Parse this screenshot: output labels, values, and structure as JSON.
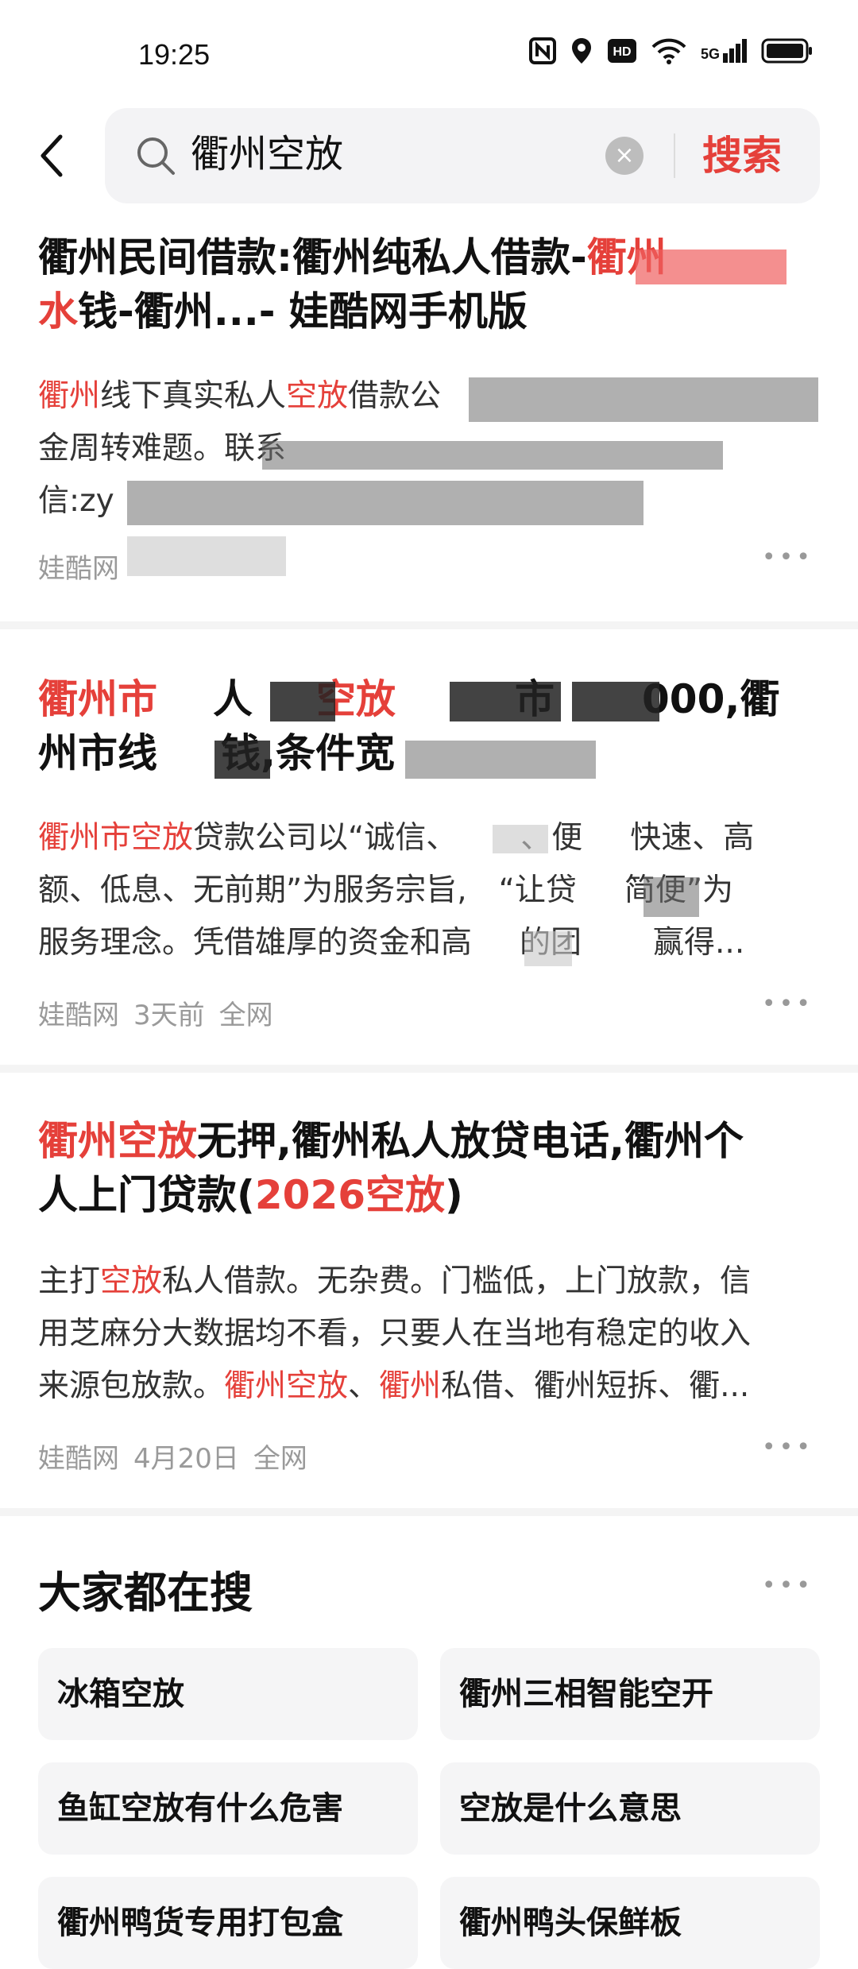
{
  "status_bar": {
    "time": "19:25",
    "network": "5G"
  },
  "search": {
    "query": "衢州空放",
    "button_label": "搜索"
  },
  "results": [
    {
      "title_parts": [
        "衢州民间借款:衢州纯私人借款-",
        "衢州",
        "",
        "水",
        "钱-衢州...- 娃酷网手机版"
      ],
      "snippet": {
        "l1a": "衢州",
        "l1b": "线下真实私人",
        "l1c": "空放",
        "l1d": "借款公",
        "l2": "金周转难题。联系",
        "l3": "信:zy"
      },
      "meta": {
        "source": "娃酷网"
      }
    },
    {
      "title_line1": {
        "a": "衢州市",
        "b": "人",
        "c": "空放",
        "d": "市",
        "e": "000,衢"
      },
      "title_line2": {
        "a": "州市线",
        "b": "钱,条件宽"
      },
      "snippet": {
        "l1a": "衢州市空放",
        "l1b": "贷款公司以“诚信、",
        "l1c": "、便",
        "l1d": "快速、高",
        "l2a": "额、低息、无前期”为服务宗旨,",
        "l2b": "“让贷",
        "l2c": "简便”为",
        "l3a": "服务理念。凭借雄厚的资金和高",
        "l3b": "的团",
        "l3c": "赢得..."
      },
      "meta": {
        "source": "娃酷网",
        "time": "3天前",
        "scope": "全网"
      }
    },
    {
      "title_line1": {
        "hl": "衢州空放",
        "rest": "无押,衢州私人放贷电话,衢州个"
      },
      "title_line2": {
        "a": "人上门贷款(",
        "hl": "2026空放",
        "b": ")"
      },
      "snippet": {
        "l1a": "主打",
        "l1hl": "空放",
        "l1b": "私人借款。无杂费。门槛低，上门放款，信",
        "l2": "用芝麻分大数据均不看，只要人在当地有稳定的收入",
        "l3a": "来源包放款。",
        "l3hl1": "衢州空放",
        "l3b": "、",
        "l3hl2": "衢州",
        "l3c": "私借、衢州短拆、衢..."
      },
      "meta": {
        "source": "娃酷网",
        "time": "4月20日",
        "scope": "全网"
      }
    }
  ],
  "hot_searches": {
    "title": "大家都在搜",
    "items": [
      "冰箱空放",
      "衢州三相智能空开",
      "鱼缸空放有什么危害",
      "空放是什么意思",
      "衢州鸭货专用打包盒",
      "衢州鸭头保鲜板"
    ]
  },
  "colors": {
    "accent": "#e5403a",
    "meta_gray": "#9a9a9a"
  }
}
